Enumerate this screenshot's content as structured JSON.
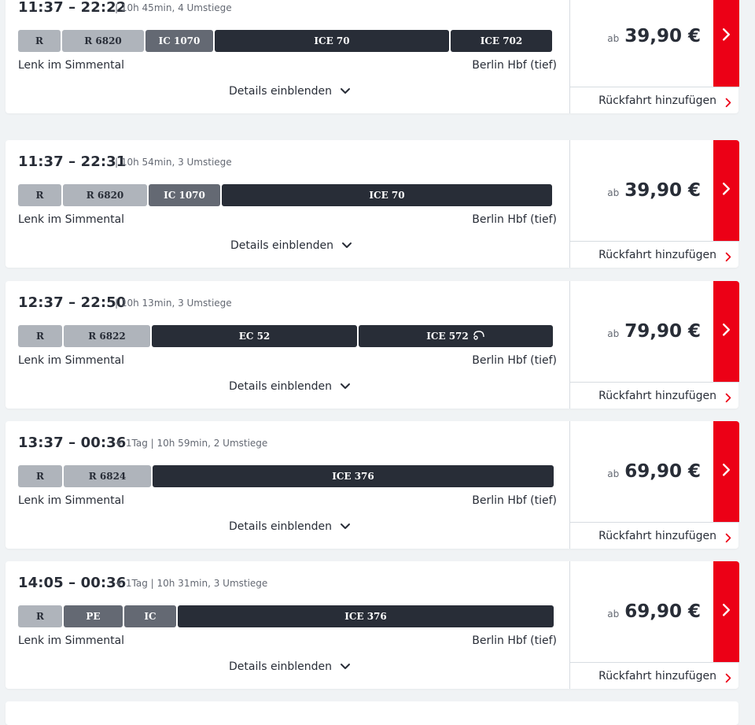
{
  "connections": [
    {
      "times": "11:37 – 22:22",
      "meta": "| 10h 45min, 4 Umstiege",
      "from": "Lenk im Simmental",
      "to": "Berlin Hbf (tief)",
      "details_label": "Details einblenden",
      "price_prefix": "ab",
      "price": "39,90 €",
      "return_label": "Rückfahrt hinzufügen",
      "segments": [
        {
          "label": "R",
          "kind": "regional",
          "share": 0.0807
        },
        {
          "label": "R 6820",
          "kind": "regional",
          "share": 0.154
        },
        {
          "label": "IC 1070",
          "kind": "ic",
          "share": 0.1276
        },
        {
          "label": "ICE 70",
          "kind": "ice",
          "share": 0.4428
        },
        {
          "label": "ICE 702",
          "kind": "ice",
          "share": 0.1907
        }
      ]
    },
    {
      "times": "11:37 – 22:31",
      "meta": "| 10h 54min, 3 Umstiege",
      "from": "Lenk im Simmental",
      "to": "Berlin Hbf (tief)",
      "details_label": "Details einblenden",
      "price_prefix": "ab",
      "price": "39,90 €",
      "return_label": "Rückfahrt hinzufügen",
      "segments": [
        {
          "label": "R",
          "kind": "regional",
          "share": 0.0807
        },
        {
          "label": "R 6820",
          "kind": "regional",
          "share": 0.1584
        },
        {
          "label": "IC 1070",
          "kind": "ic",
          "share": 0.1349
        },
        {
          "label": "ICE 70",
          "kind": "ice",
          "share": 0.6217
        }
      ]
    },
    {
      "times": "12:37 – 22:50",
      "meta": "| 10h 13min, 3 Umstiege",
      "from": "Lenk im Simmental",
      "to": "Berlin Hbf (tief)",
      "details_label": "Details einblenden",
      "price_prefix": "ab",
      "price": "79,90 €",
      "return_label": "Rückfahrt hinzufügen",
      "segments": [
        {
          "label": "R",
          "kind": "regional",
          "share": 0.0833
        },
        {
          "label": "R 6822",
          "kind": "regional",
          "share": 0.1625
        },
        {
          "label": "EC 52",
          "kind": "ice",
          "share": 0.386
        },
        {
          "label": "ICE 572",
          "kind": "ice",
          "share": 0.3655,
          "bike": true
        }
      ]
    },
    {
      "times": "13:37 – 00:36",
      "meta": "+ 1Tag | 10h 59min, 2 Umstiege",
      "from": "Lenk im Simmental",
      "to": "Berlin Hbf (tief)",
      "details_label": "Details einblenden",
      "price_prefix": "ab",
      "price": "69,90 €",
      "return_label": "Rückfahrt hinzufügen",
      "segments": [
        {
          "label": "R",
          "kind": "regional",
          "share": 0.0833
        },
        {
          "label": "R 6824",
          "kind": "regional",
          "share": 0.164
        },
        {
          "label": "ICE 376",
          "kind": "ice",
          "share": 0.7526
        }
      ]
    },
    {
      "times": "14:05 – 00:36",
      "meta": "+ 1Tag | 10h 31min, 3 Umstiege",
      "from": "Lenk im Simmental",
      "to": "Berlin Hbf (tief)",
      "details_label": "Details einblenden",
      "price_prefix": "ab",
      "price": "69,90 €",
      "return_label": "Rückfahrt hinzufügen",
      "segments": [
        {
          "label": "R",
          "kind": "regional",
          "share": 0.0833
        },
        {
          "label": "PE",
          "kind": "ic",
          "share": 0.1113
        },
        {
          "label": "IC",
          "kind": "ic",
          "share": 0.0981
        },
        {
          "label": "ICE 376",
          "kind": "ice",
          "share": 0.7073
        }
      ]
    }
  ],
  "colors": {
    "accent_red": "#ec0016",
    "ice": "#282d37",
    "ic": "#646973",
    "regional": "#afb4bb"
  },
  "icons": {
    "next": "chevron-right-icon",
    "expand": "chevron-down-icon",
    "bike": "bicycle-icon"
  }
}
